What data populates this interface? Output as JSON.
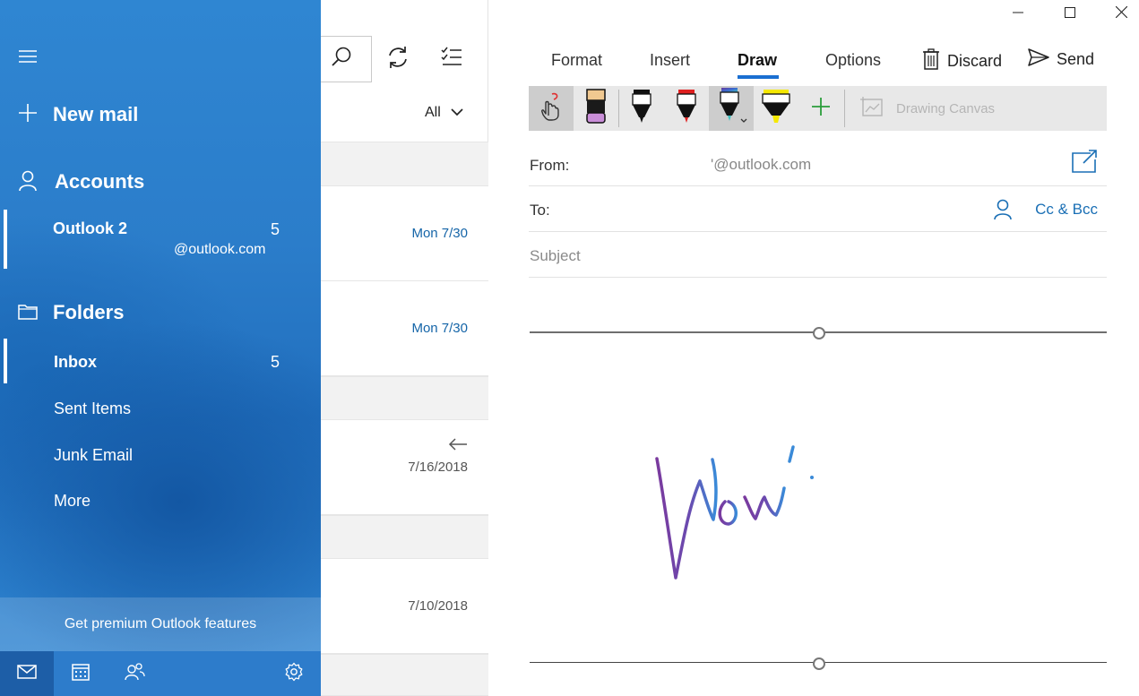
{
  "nav": {
    "new_mail": "New mail",
    "accounts_heading": "Accounts",
    "account": {
      "name": "Outlook 2",
      "unread": "5",
      "email": "@outlook.com"
    },
    "folders_heading": "Folders",
    "folders": [
      {
        "label": "Inbox",
        "count": "5"
      },
      {
        "label": "Sent Items",
        "count": ""
      },
      {
        "label": "Junk Email",
        "count": ""
      },
      {
        "label": "More",
        "count": ""
      }
    ],
    "premium": "Get premium Outlook features",
    "bottom_icons": [
      "mail-icon",
      "calendar-icon",
      "people-icon",
      "settings-icon"
    ]
  },
  "message_list": {
    "filter": "All",
    "items": [
      {
        "date": "Mon 7/30",
        "replied": false
      },
      {
        "date": "Mon 7/30",
        "replied": false
      },
      {
        "date": "7/16/2018",
        "replied": true
      },
      {
        "date": "7/10/2018",
        "replied": false
      }
    ]
  },
  "compose": {
    "tabs": [
      "Format",
      "Insert",
      "Draw",
      "Options"
    ],
    "active_tab": "Draw",
    "discard": "Discard",
    "send": "Send",
    "toolbar": {
      "tools": [
        "touch-draw-icon",
        "eraser-icon",
        "pen-black-icon",
        "pen-red-icon",
        "pen-galaxy-icon",
        "highlighter-yellow-icon",
        "add-pen-icon"
      ],
      "drawing_canvas": "Drawing Canvas"
    },
    "from_label": "From:",
    "from_value": "'@outlook.com",
    "to_label": "To:",
    "cc_bcc": "Cc & Bcc",
    "subject_placeholder": "Subject"
  },
  "colors": {
    "nav_blue": "#2b7dca",
    "accent": "#1a6fd1",
    "link": "#1a6fb5",
    "ink_purple": "#7b3aa0",
    "ink_blue": "#3a7bd5"
  }
}
